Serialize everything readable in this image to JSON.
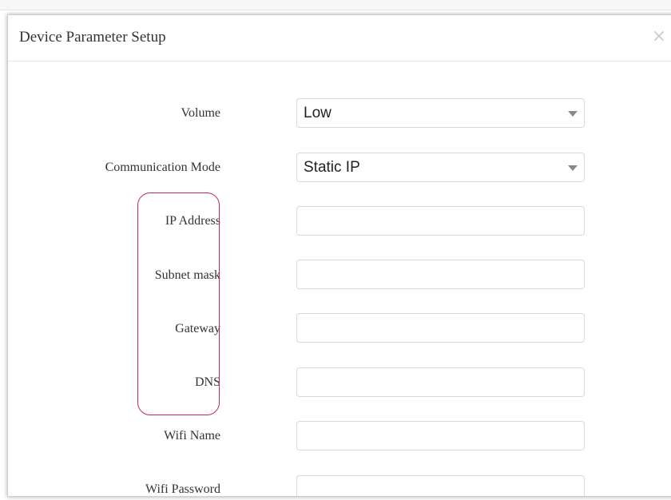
{
  "dialog": {
    "title": "Device Parameter Setup",
    "close_glyph": "×",
    "close_icon": "close-icon"
  },
  "form": {
    "volume": {
      "label": "Volume",
      "value": "Low"
    },
    "communication_mode": {
      "label": "Communication Mode",
      "value": "Static IP"
    },
    "ip_address": {
      "label": "IP Address",
      "value": ""
    },
    "subnet_mask": {
      "label": "Subnet mask",
      "value": ""
    },
    "gateway": {
      "label": "Gateway",
      "value": ""
    },
    "dns": {
      "label": "DNS",
      "value": ""
    },
    "wifi_name": {
      "label": "Wifi Name",
      "value": ""
    },
    "wifi_password": {
      "label": "Wifi Password",
      "value": ""
    }
  },
  "colors": {
    "highlight": "#c2246e",
    "border": "#d9d9d9",
    "caret": "#888888"
  }
}
